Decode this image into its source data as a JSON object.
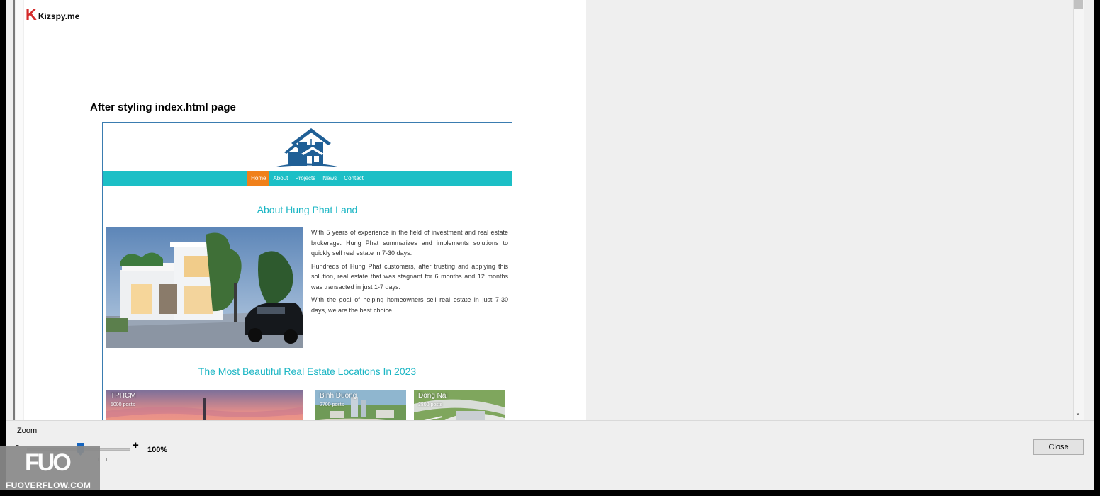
{
  "brand": {
    "mark": "K",
    "name": "Kizspy.me"
  },
  "document": {
    "caption": "After styling index.html page",
    "site": {
      "nav": [
        "Home",
        "About",
        "Projects",
        "News",
        "Contact"
      ],
      "active_nav": "Home",
      "about_title": "About Hung Phat Land",
      "about_paragraphs": [
        "With 5 years of experience in the field of investment and real estate brokerage. Hung Phat summarizes and implements solutions to quickly sell real estate in 7-30 days.",
        "Hundreds of Hung Phat customers, after trusting and applying this solution, real estate that was stagnant for 6 months and 12 months was transacted in just 1-7 days.",
        "With the goal of helping homeowners sell real estate in just 7-30 days, we are the best choice."
      ],
      "locations_title": "The Most Beautiful Real Estate Locations In 2023",
      "locations": [
        {
          "name": "TPHCM",
          "posts": "5000 posts"
        },
        {
          "name": "Binh Duong",
          "posts": "2700 posts"
        },
        {
          "name": "Dong Nai",
          "posts": "3800 posts"
        }
      ],
      "colors": {
        "accent": "#1cbfc6",
        "active": "#f0801a",
        "house": "#1f5f96"
      }
    }
  },
  "viewer": {
    "zoom_label": "Zoom",
    "zoom_minus": "-",
    "zoom_plus": "+",
    "zoom_value": "100%",
    "close_label": "Close",
    "scroll_down_icon": "chevron-down-icon"
  },
  "watermark": {
    "big": "FUO",
    "small": "FUOVERFLOW.COM"
  }
}
